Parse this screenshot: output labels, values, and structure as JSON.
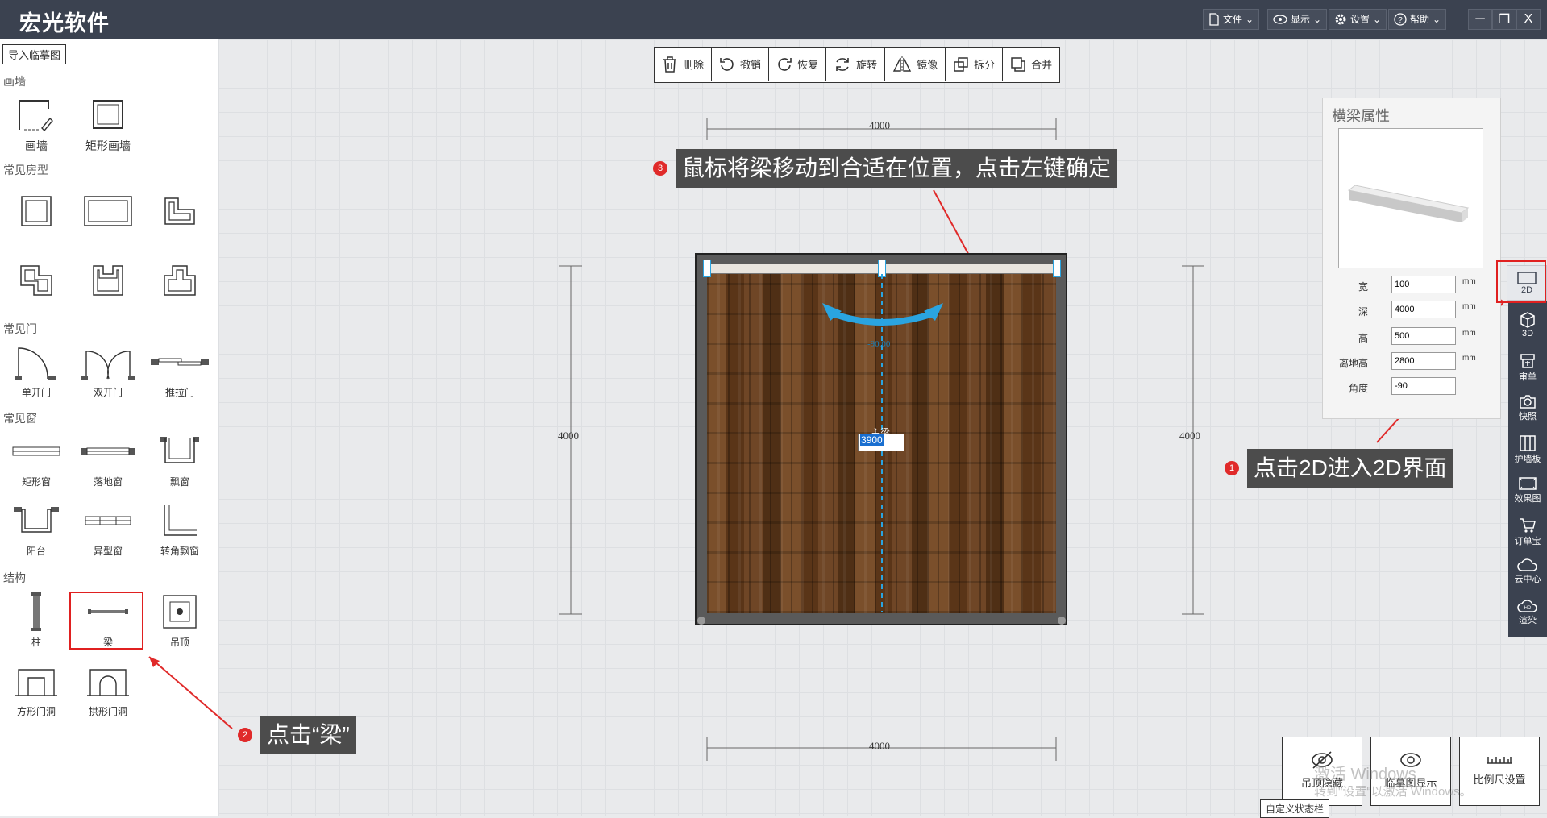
{
  "app": {
    "title": "宏光软件",
    "menu": [
      {
        "label": "文件",
        "icon": "file-icon"
      },
      {
        "label": "显示",
        "icon": "eye-icon"
      },
      {
        "label": "设置",
        "icon": "gear-icon"
      },
      {
        "label": "帮助",
        "icon": "help-icon"
      }
    ],
    "window_buttons": [
      "─",
      "❐",
      "X"
    ]
  },
  "left_panel": {
    "import_button": "导入临摹图",
    "sections": {
      "draw_wall": "画墙",
      "common_rooms": "常见房型",
      "common_doors": "常见门",
      "common_windows": "常见窗",
      "structure": "结构"
    },
    "draw_wall_tools": [
      "画墙",
      "矩形画墙"
    ],
    "door_tools": [
      "单开门",
      "双开门",
      "推拉门"
    ],
    "window_tools": [
      "矩形窗",
      "落地窗",
      "飘窗",
      "阳台",
      "异型窗",
      "转角飘窗"
    ],
    "structure_tools": [
      "柱",
      "梁",
      "吊顶",
      "方形门洞",
      "拱形门洞"
    ]
  },
  "toolbar": {
    "delete": "删除",
    "undo": "撤销",
    "redo": "恢复",
    "rotate": "旋转",
    "mirror": "镜像",
    "split": "拆分",
    "merge": "合并"
  },
  "canvas": {
    "dim_top": "4000",
    "dim_bottom": "4000",
    "dim_left": "4000",
    "dim_right": "4000",
    "angle_label": "-90.00",
    "beam_label": "主梁",
    "length_input": "3900"
  },
  "callouts": {
    "step1": {
      "num": "1",
      "text": "点击2D进入2D界面"
    },
    "step2": {
      "num": "2",
      "text": "点击“梁”"
    },
    "step3": {
      "num": "3",
      "text": "鼠标将梁移动到合适在位置，点击左键确定"
    }
  },
  "properties": {
    "title": "横梁属性",
    "fields": [
      {
        "label": "宽",
        "value": "100",
        "unit": "mm"
      },
      {
        "label": "深",
        "value": "4000",
        "unit": "mm"
      },
      {
        "label": "高",
        "value": "500",
        "unit": "mm"
      },
      {
        "label": "离地高",
        "value": "2800",
        "unit": "mm"
      },
      {
        "label": "角度",
        "value": "-90",
        "unit": ""
      }
    ]
  },
  "right_sidebar": [
    "2D",
    "3D",
    "审单",
    "快照",
    "护墙板",
    "效果图",
    "订单宝",
    "云中心",
    "渲染"
  ],
  "bottom_buttons": {
    "ceiling_hide": "吊顶隐藏",
    "trace_show": "临摹图显示",
    "scale_setting": "比例尺设置",
    "status_bar": "自定义状态栏"
  },
  "watermark": {
    "line1": "激活 Windows",
    "line2": "转到\"设置\"以激活 Windows。"
  },
  "colors": {
    "titlebar": "#3b4250",
    "accent_red": "#e02020",
    "beam_blue": "#2aa4e0"
  }
}
